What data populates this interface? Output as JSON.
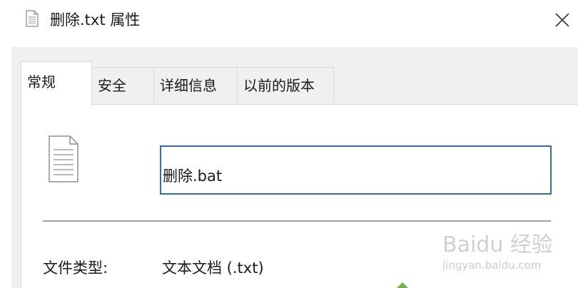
{
  "window": {
    "title": "删除.txt 属性",
    "icon": "text-file-icon",
    "close_icon": "close-icon"
  },
  "tabs": [
    {
      "label": "常规",
      "active": true
    },
    {
      "label": "安全",
      "active": false
    },
    {
      "label": "详细信息",
      "active": false
    },
    {
      "label": "以前的版本",
      "active": false
    }
  ],
  "general": {
    "file_icon": "document-icon",
    "name_value": "删除.bat",
    "properties": [
      {
        "label": "文件类型:",
        "value": "文本文档 (.txt)"
      }
    ]
  },
  "watermark": {
    "main": "Baidu 经验",
    "sub": "jingyan.baidu.com"
  },
  "colors": {
    "client_bg": "#f0f0f0",
    "panel_bg": "#ffffff",
    "focus_border": "#2e6fb7"
  }
}
